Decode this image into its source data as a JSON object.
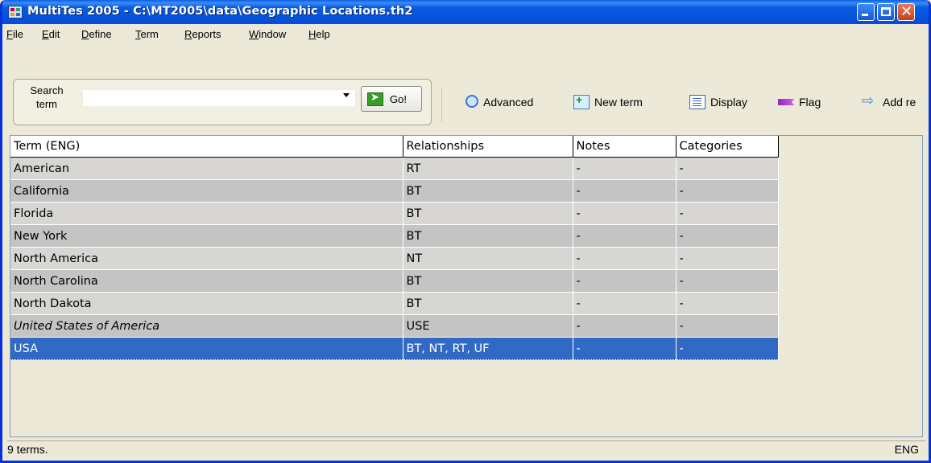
{
  "window": {
    "title": "MultiTes 2005 - C:\\MT2005\\data\\Geographic Locations.th2",
    "controls": [
      "minimize-icon",
      "maximize-icon",
      "close-icon"
    ]
  },
  "menu": {
    "items": [
      {
        "key": "F",
        "rest": "ile"
      },
      {
        "key": "E",
        "rest": "dit"
      },
      {
        "key": "D",
        "rest": "efine"
      },
      {
        "key": "T",
        "rest": "erm"
      },
      {
        "key": "R",
        "rest": "eports"
      },
      {
        "key": "W",
        "rest": "indow"
      },
      {
        "key": "H",
        "rest": "elp"
      }
    ]
  },
  "search": {
    "label": "Search term",
    "value": "",
    "go_label": "Go!"
  },
  "toolbar": {
    "advanced": "Advanced",
    "new_term": "New term",
    "display": "Display",
    "flag": "Flag",
    "add_relationship": "Add re"
  },
  "table": {
    "headers": [
      "Term (ENG)",
      "Relationships",
      "Notes",
      "Categories"
    ],
    "rows": [
      [
        "American",
        "RT",
        "-",
        "-"
      ],
      [
        "California",
        "BT",
        "-",
        "-"
      ],
      [
        "Florida",
        "BT",
        "-",
        "-"
      ],
      [
        "New York",
        "BT",
        "-",
        "-"
      ],
      [
        "North America",
        "NT",
        "-",
        "-"
      ],
      [
        "North Carolina",
        "BT",
        "-",
        "-"
      ],
      [
        "North Dakota",
        "BT",
        "-",
        "-"
      ],
      [
        "United States of America",
        "USE",
        "-",
        "-"
      ],
      [
        "USA",
        "BT, NT, RT, UF",
        "-",
        "-"
      ]
    ],
    "selected_row": 8,
    "italic_row": 7
  },
  "status": {
    "left": "9 terms.",
    "right": "ENG"
  },
  "colors": {
    "titlebar": "#0453dc",
    "selection": "#316ac5",
    "row_light": "#d7d6d3",
    "row_dark": "#c4c4c4"
  }
}
